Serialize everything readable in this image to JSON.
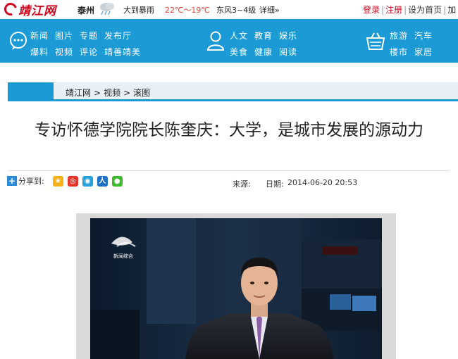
{
  "topbar": {
    "logo_text": "靖江网",
    "city": "泰州",
    "weather_icon": "rain-cloud-icon",
    "weather": "大到暴雨",
    "temperature": "22℃～19℃",
    "wind": "东风3~4级",
    "detail": "详细»",
    "login": "登录",
    "register": "注册",
    "set_home": "设为首页",
    "more": "加",
    "sep": "|"
  },
  "nav": {
    "group1": {
      "icon": "chat-bubble-icon",
      "row1": [
        "新闻",
        "图片",
        "专题",
        "发布厅"
      ],
      "row2": [
        "爆料",
        "视频",
        "评论",
        "靖善靖美"
      ]
    },
    "group2": {
      "icon": "person-icon",
      "row1": [
        "人文",
        "教育",
        "娱乐"
      ],
      "row2": [
        "美食",
        "健康",
        "阅读"
      ]
    },
    "group3": {
      "icon": "basket-icon",
      "row1": [
        "旅游",
        "汽车"
      ],
      "row2": [
        "楼市",
        "家居"
      ]
    }
  },
  "breadcrumb": {
    "items": [
      "靖江网",
      "视频",
      "滚图"
    ],
    "sep": ">"
  },
  "article": {
    "title": "专访怀德学院院长陈奎庆：大学，是城市发展的源动力",
    "share_label": "分享到:",
    "share_icons": [
      "qzone-icon",
      "weibo-icon",
      "tencent-weibo-icon",
      "renren-icon",
      "wechat-icon"
    ],
    "source_label": "来源:",
    "date_label": "日期:",
    "date": "2014-06-20 20:53"
  },
  "colors": {
    "brand_blue": "#1b9ad6",
    "brand_red": "#d0021b",
    "temp_red": "#e8432f"
  },
  "video": {
    "channel_logo_text": "新闻综合"
  }
}
